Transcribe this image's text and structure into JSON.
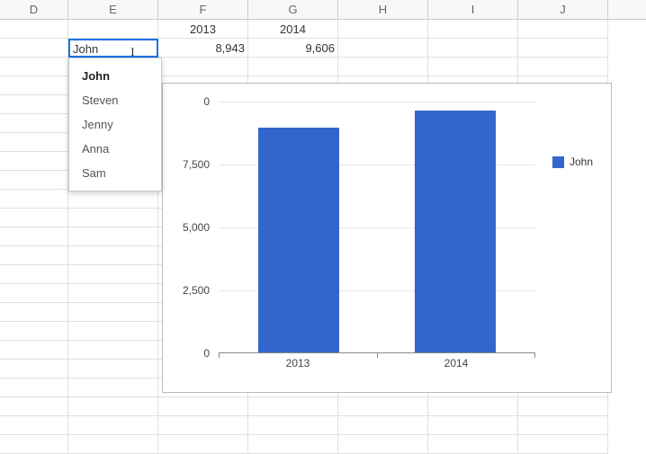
{
  "columns": {
    "D": "D",
    "E": "E",
    "F": "F",
    "G": "G",
    "H": "H",
    "I": "I",
    "J": "J"
  },
  "cells": {
    "F1": "2013",
    "G1": "2014",
    "E2_value": "John",
    "F2": "8,943",
    "G2": "9,606"
  },
  "dropdown": {
    "items": [
      "John",
      "Steven",
      "Jenny",
      "Anna",
      "Sam"
    ],
    "selected_index": 0
  },
  "chart_data": {
    "type": "bar",
    "categories": [
      "2013",
      "2014"
    ],
    "series": [
      {
        "name": "John",
        "values": [
          8943,
          9606
        ]
      }
    ],
    "ylim": [
      0,
      10000
    ],
    "yticks": [
      0,
      2500,
      5000,
      7500
    ],
    "ytick_labels": [
      "0",
      "2,500",
      "5,000",
      "7,500"
    ],
    "partial_tick_label": "0"
  },
  "legend": {
    "label": "John"
  }
}
